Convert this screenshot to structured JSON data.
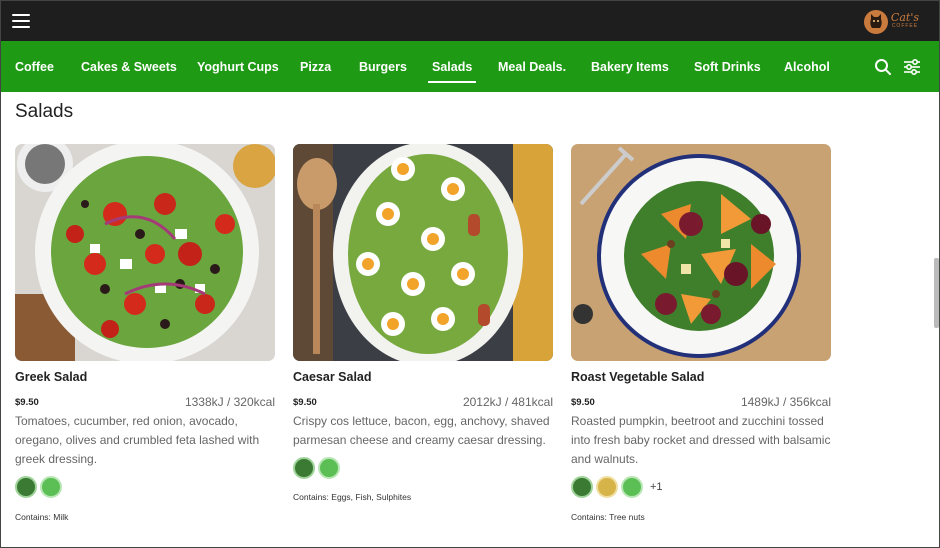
{
  "topbar": {
    "menu_icon": "hamburger-icon",
    "logo_name": "Cat's",
    "logo_sub": "COFFEE"
  },
  "nav": {
    "items": [
      "Coffee",
      "Cakes & Sweets",
      "Yoghurt Cups",
      "Pizza",
      "Burgers",
      "Salads",
      "Meal Deals.",
      "Bakery Items",
      "Soft Drinks",
      "Alcohol"
    ],
    "active": "Salads",
    "icons": [
      "search-icon",
      "filter-sliders-icon"
    ],
    "color": "#1f9a14"
  },
  "page": {
    "title": "Salads"
  },
  "products": [
    {
      "name": "Greek Salad",
      "price": "$9.50",
      "energy": "1338kJ / 320kcal",
      "description": "Tomatoes, cucumber, red onion, avocado, oregano, olives and crumbled feta lashed with greek dressing.",
      "badges": [
        "vegetarian-badge",
        "gluten-free-badge"
      ],
      "more": "",
      "contains": "Contains: Milk"
    },
    {
      "name": "Caesar Salad",
      "price": "$9.50",
      "energy": "2012kJ / 481kcal",
      "description": "Crispy cos lettuce, bacon, egg, anchovy, shaved parmesan cheese and creamy caesar dressing.",
      "badges": [
        "vegetarian-badge",
        "gluten-free-badge"
      ],
      "more": "",
      "contains": "Contains: Eggs, Fish, Sulphites"
    },
    {
      "name": "Roast Vegetable Salad",
      "price": "$9.50",
      "energy": "1489kJ / 356kcal",
      "description": "Roasted pumpkin, beetroot and zucchini tossed into fresh baby rocket and dressed with balsamic and walnuts.",
      "badges": [
        "vegetarian-badge",
        "vegan-badge",
        "gluten-free-badge"
      ],
      "more": "+1",
      "contains": "Contains: Tree nuts"
    }
  ]
}
